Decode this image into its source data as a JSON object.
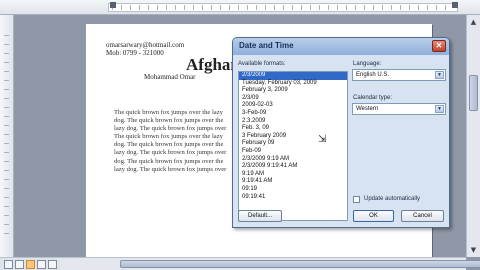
{
  "document": {
    "email": "omarsarwary@hotmail.com",
    "mobile": "Mob: 0799 - 321000",
    "title": "Afghan",
    "author": "Mohammad Omar",
    "body_lines": [
      "The quick brown fox jumps over the lazy",
      "dog.  The quick brown fox jumps over the",
      "lazy dog.  The quick brown fox jumps over",
      "The quick brown fox jumps over the lazy",
      "dog.  The quick brown fox jumps over the",
      "lazy dog.  The quick brown fox jumps over",
      "dog.  The quick brown fox jumps over the",
      "lazy dog.  The quick brown fox jumps over"
    ]
  },
  "dialog": {
    "title": "Date and Time",
    "close_label": "✕",
    "available_formats_label": "Available formats:",
    "formats": [
      "2/3/2009",
      "Tuesday, February 03, 2009",
      "February 3, 2009",
      "2/3/09",
      "2009-02-03",
      "3-Feb-09",
      "2.3.2009",
      "Feb. 3, 09",
      "3 February 2009",
      "February 09",
      "Feb-09",
      "2/3/2009 9:19 AM",
      "2/3/2009 9:19:41 AM",
      "9:19 AM",
      "9:19:41 AM",
      "09:19",
      "09:19:41"
    ],
    "selected_index": 0,
    "language_label": "Language:",
    "language_value": "English U.S.",
    "calendar_label": "Calendar type:",
    "calendar_value": "Western",
    "update_label": "Update automatically",
    "default_button": "Default...",
    "ok_button": "OK",
    "cancel_button": "Cancel"
  },
  "icons": {
    "combo_arrow": "▼",
    "scroll_up": "▲",
    "scroll_down": "▼",
    "cursor": "⇲"
  }
}
